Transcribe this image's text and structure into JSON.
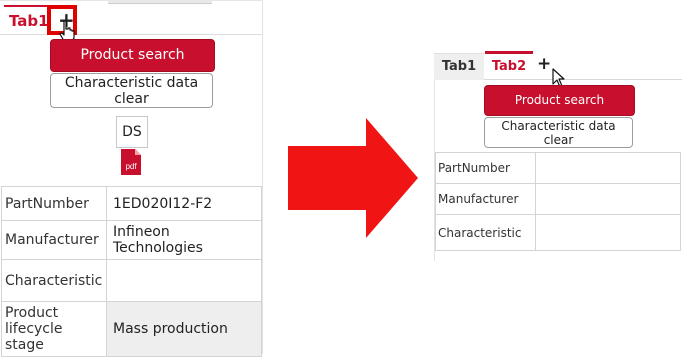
{
  "left_panel": {
    "tab1_label": "Tab1",
    "add_tab_symbol": "+",
    "product_search_label": "Product search",
    "clear_label": "Characteristic data clear",
    "ds_label": "DS",
    "pdf_label": "pdf",
    "rows": [
      {
        "key": "PartNumber",
        "value": "1ED020I12-F2"
      },
      {
        "key": "Manufacturer",
        "value": "Infineon Technologies"
      },
      {
        "key": "Characteristic",
        "value": ""
      },
      {
        "key": "Product lifecycle stage",
        "value": "Mass production"
      }
    ]
  },
  "right_panel": {
    "tab1_label": "Tab1",
    "tab2_label": "Tab2",
    "add_tab_symbol": "+",
    "product_search_label": "Product search",
    "clear_label": "Characteristic data clear",
    "rows": [
      {
        "key": "PartNumber",
        "value": ""
      },
      {
        "key": "Manufacturer",
        "value": ""
      },
      {
        "key": "Characteristic",
        "value": ""
      }
    ]
  },
  "colors": {
    "brand_red": "#c8102e",
    "highlight_red": "#e00000",
    "arrow_red": "#f01414"
  },
  "icons": {
    "add_tab": "plus-icon",
    "cursor": "hand-pointer-icon",
    "datasheet": "pdf-icon",
    "transition": "right-arrow-icon"
  }
}
